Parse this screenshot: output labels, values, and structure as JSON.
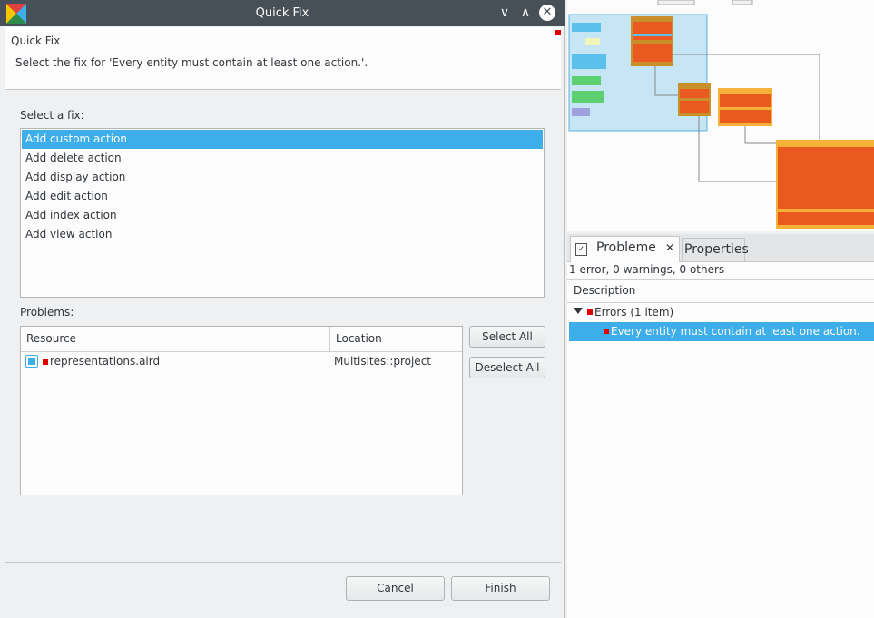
{
  "dialog": {
    "title": "Quick Fix",
    "header_title": "Quick Fix",
    "header_message": "Select the fix for 'Every entity must contain at least one action.'.",
    "select_fix_label": "Select a fix:",
    "fixes": [
      {
        "label": "Add custom action",
        "selected": true
      },
      {
        "label": "Add delete action",
        "selected": false
      },
      {
        "label": "Add display action",
        "selected": false
      },
      {
        "label": "Add edit action",
        "selected": false
      },
      {
        "label": "Add index action",
        "selected": false
      },
      {
        "label": "Add view action",
        "selected": false
      }
    ],
    "problems_label": "Problems:",
    "columns": [
      "Resource",
      "Location"
    ],
    "rows": [
      {
        "resource": "representations.aird",
        "location": "Multisites::project",
        "checked": true
      }
    ],
    "select_all": "Select All",
    "deselect_all": "Deselect All",
    "cancel": "Cancel",
    "finish": "Finish"
  },
  "window_controls": {
    "minimize": "∨",
    "maximize": "∧",
    "close": "✕"
  },
  "problems_view": {
    "tab_label": "Probleme",
    "tab_close": "✕",
    "properties_tab": "Properties",
    "summary": "1 error, 0 warnings, 0 others",
    "column": "Description",
    "group": "Errors (1 item)",
    "error_item": "Every entity must contain at least one action."
  },
  "colors": {
    "selection": "#3daee9",
    "titlebar": "#475057",
    "error_marker": "#e00000",
    "diagram_orange": "#ea5a20",
    "diagram_brown": "#c9902a",
    "diagram_blue": "#5bc0eb"
  }
}
